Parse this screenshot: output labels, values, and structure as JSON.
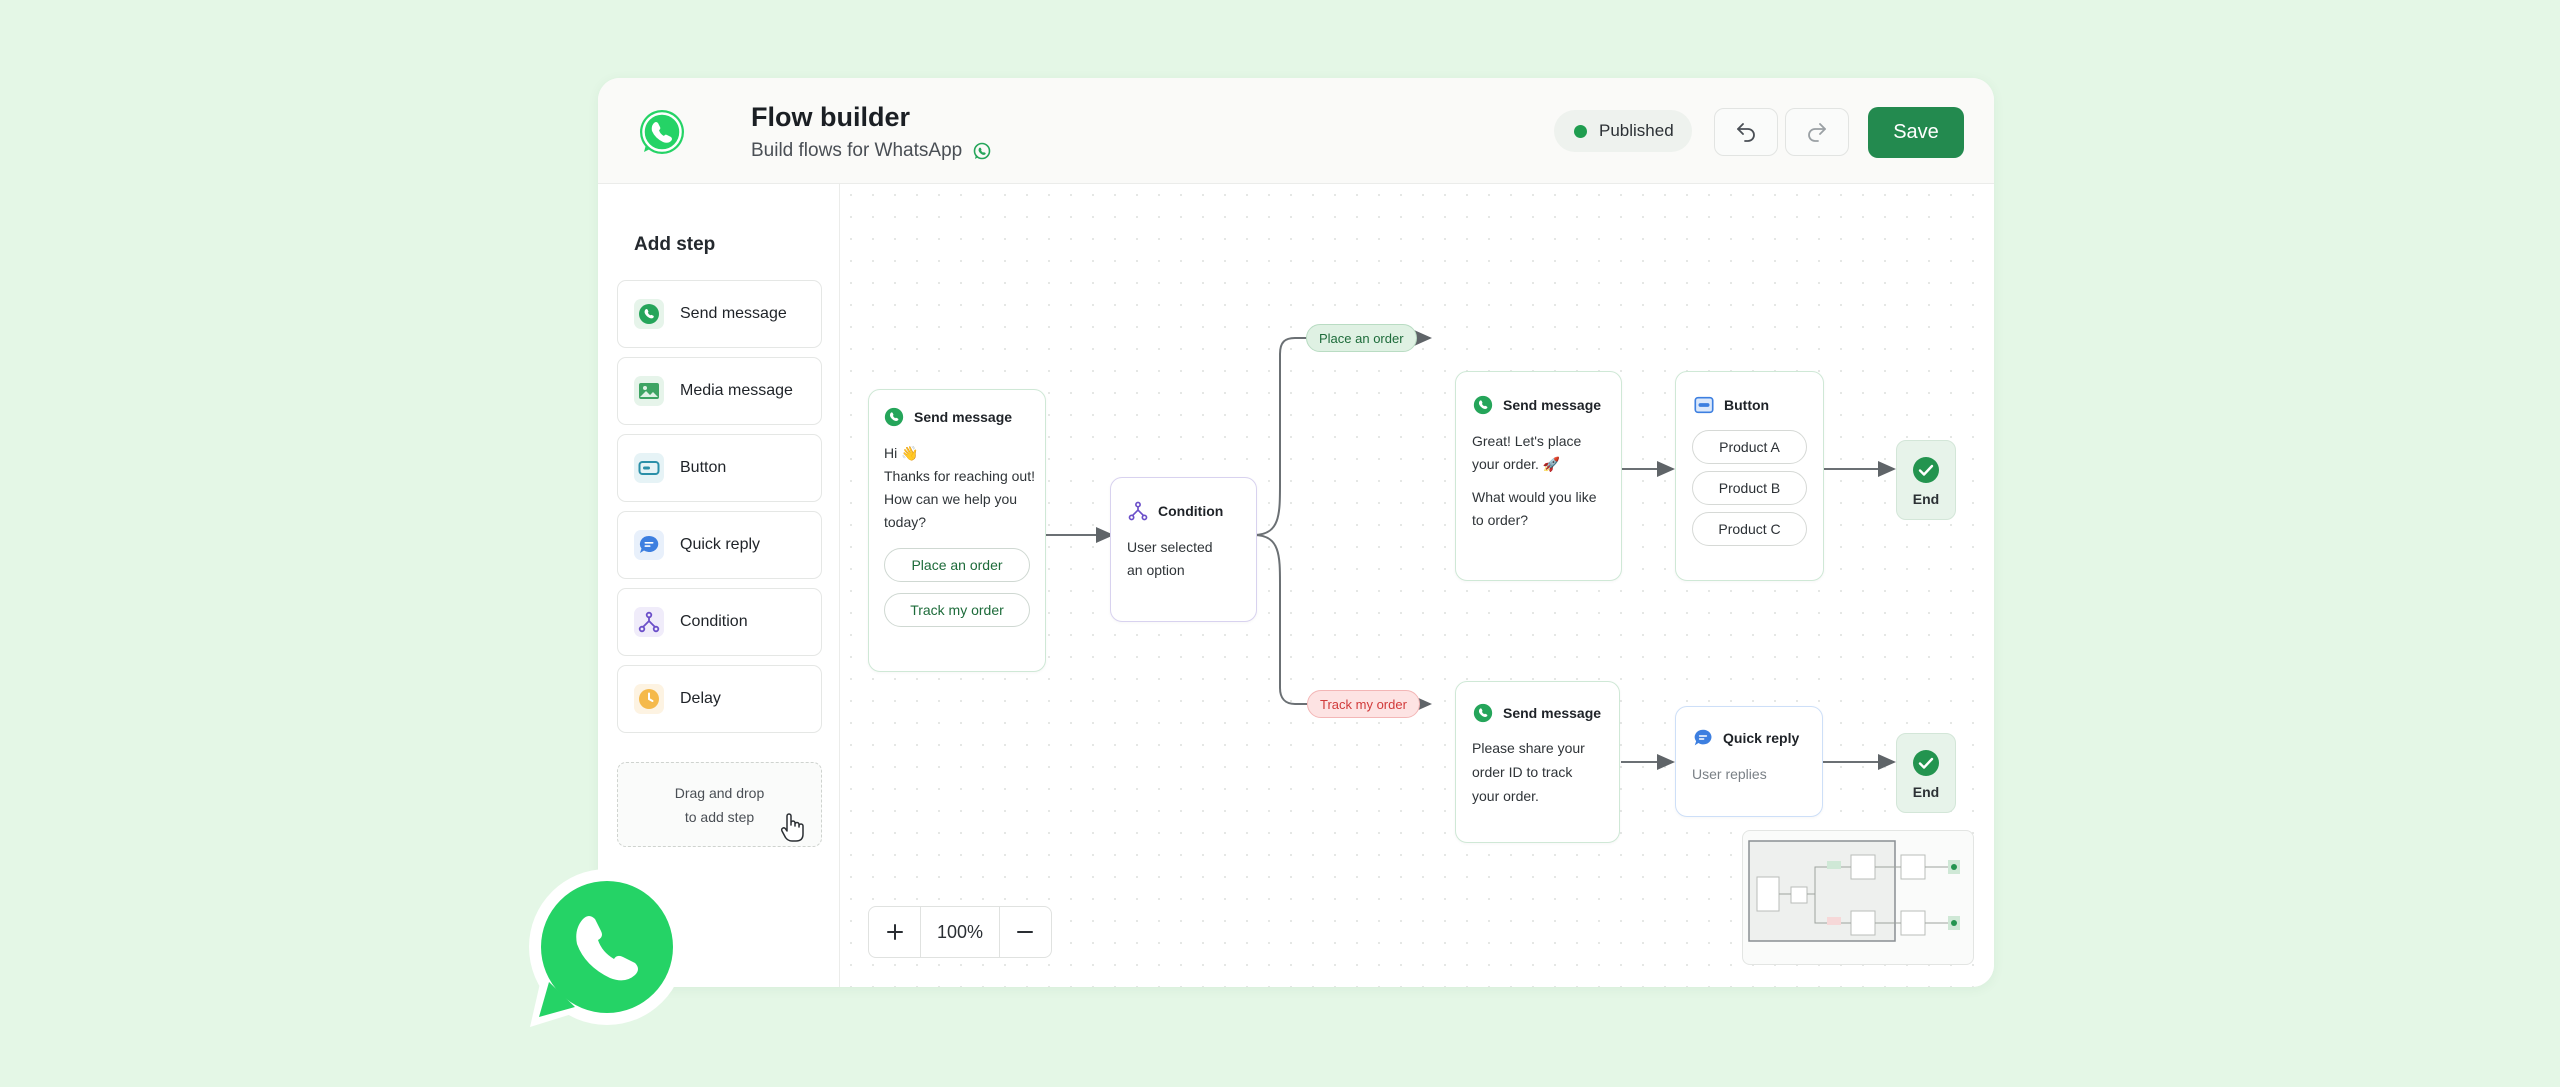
{
  "header": {
    "title": "Flow builder",
    "subtitle": "Build flows for WhatsApp",
    "status": "Published",
    "save_label": "Save"
  },
  "colors": {
    "brand_green": "#25d366",
    "save_green": "#238a4f",
    "background": "#e4f7e6",
    "status_dot": "#1f9d4f",
    "track_red": "#d13a3a"
  },
  "sidebar": {
    "title": "Add step",
    "items": [
      {
        "label": "Send message",
        "icon": "whatsapp-icon"
      },
      {
        "label": "Media message",
        "icon": "image-icon"
      },
      {
        "label": "Button",
        "icon": "button-icon"
      },
      {
        "label": "Quick reply",
        "icon": "chat-bubble-icon"
      },
      {
        "label": "Condition",
        "icon": "branch-icon"
      },
      {
        "label": "Delay",
        "icon": "clock-icon"
      }
    ],
    "drop_zone": {
      "line1": "Drag and drop",
      "line2": "to add step"
    }
  },
  "canvas": {
    "start_node": {
      "title": "Send message",
      "text": [
        "Hi 👋",
        "Thanks for reaching out!",
        "How can we help you",
        "today?"
      ],
      "options": [
        "Place an order",
        "Track my order"
      ]
    },
    "condition_node": {
      "title": "Condition",
      "text": [
        "User selected",
        "an option"
      ]
    },
    "edge_labels": {
      "top": "Place an order",
      "bottom": "Track my order"
    },
    "order_message": {
      "title": "Send message",
      "text": [
        "Great! Let's place",
        "your order. 🚀",
        "What would you like",
        "to order?"
      ]
    },
    "button_node": {
      "title": "Button",
      "options": [
        "Product A",
        "Product B",
        "Product C"
      ]
    },
    "track_message": {
      "title": "Send message",
      "text": [
        "Please share your",
        "order ID to track",
        "your order."
      ]
    },
    "quick_reply_node": {
      "title": "Quick reply",
      "text": "User replies"
    },
    "end_label": "End",
    "zoom": "100%"
  }
}
